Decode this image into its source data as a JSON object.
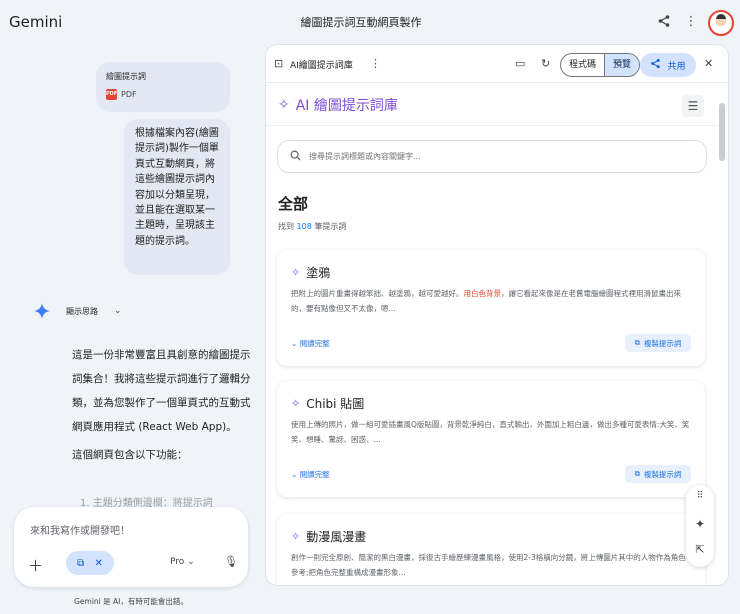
{
  "app": {
    "brand": "Gemini",
    "conversation_title": "繪圖提示詞互動網頁製作"
  },
  "topbar": {
    "share_icon": "share-icon",
    "more_icon": "more-vert-icon"
  },
  "chat": {
    "attachment": {
      "name": "繪圖提示詞",
      "type": "PDF"
    },
    "user_message": "根據檔案內容(繪圖提示詞)製作一個單頁式互動網頁，將這些繪圖提示詞內容加以分類呈現，並且能在選取某一主題時，呈現該主題的提示詞。",
    "thinking_label": "顯示思路",
    "answer_paragraphs": [
      "這是一份非常豐富且具創意的繪圖提示詞集合！我將這些提示詞進行了邏輯分類，並為您製作了一個單頁式的互動式網頁應用程式 (React Web App)。",
      "這個網頁包含以下功能："
    ],
    "answer_list_item": "1. 主題分類側邊欄：將提示詞"
  },
  "composer": {
    "placeholder": "來和我寫作或開發吧！",
    "model": "Pro",
    "disclaimer": "Gemini 是 AI，有時可能會出錯。"
  },
  "canvas": {
    "title": "AI繪圖提示詞庫",
    "tab_code": "程式碼",
    "tab_preview": "預覽",
    "share_label": "共用",
    "app": {
      "logo_text": "AI 繪圖提示詞庫",
      "search_placeholder": "搜尋提示詞標題或內容關鍵字...",
      "section_title": "全部",
      "found_prefix": "找到",
      "found_count": "108",
      "found_suffix": "筆提示詞",
      "expand_label": "閱讀完整",
      "copy_label": "複製提示詞",
      "cards": [
        {
          "title": "塗鴉",
          "desc_before": "把附上的圖片重畫得越笨拙、越塗鴉，越可愛越好。",
          "desc_highlight": "用白色背景",
          "desc_after": "，讓它看起來像是在老舊電腦繪圖程式裡用滑鼠畫出來的，要有點像但又不太像，嗯..."
        },
        {
          "title": "Chibi 貼圖",
          "desc": "使用上傳的照片，做一組可愛插畫風Q版貼圖，背景乾淨純白，直式輸出，外圍加上粗白邊，做出多種可愛表情:大笑、笑笑、想睡、驚訝、困惑、..."
        },
        {
          "title": "動漫風漫畫",
          "desc": "創作一則完全原創、簡潔的黑白漫畫，採復古手繪歷練漫畫風格，使用2-3格橫向分鏡，將上傳圖片其中的人物作為角色參考;把角色完整重構成漫畫形象..."
        }
      ]
    }
  }
}
